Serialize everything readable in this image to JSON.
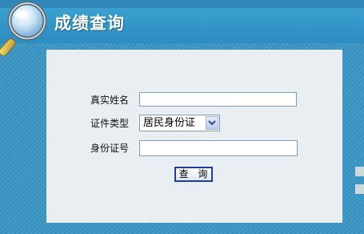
{
  "header": {
    "title": "成绩查询",
    "logo_icon": "magnifier-icon"
  },
  "form": {
    "name_label": "真实姓名",
    "name_value": "",
    "id_type_label": "证件类型",
    "id_type_selected": "居民身份证",
    "id_number_label": "身份证号",
    "id_number_value": "",
    "submit_label": "查 询"
  },
  "colors": {
    "background": "#3a95c4",
    "panel": "#e8eef1",
    "button_border": "#1c3e9a"
  }
}
